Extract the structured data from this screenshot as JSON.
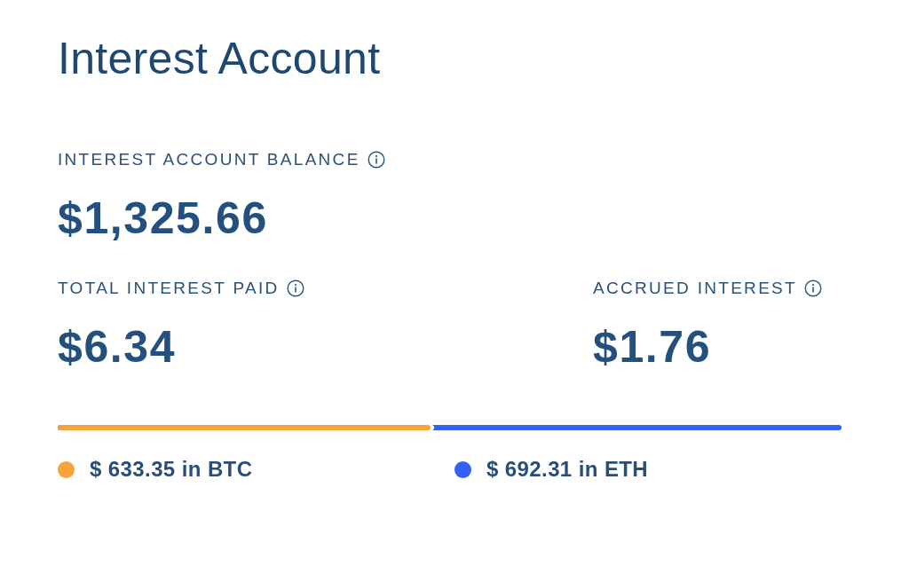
{
  "title": "Interest Account",
  "balance": {
    "label": "INTEREST ACCOUNT BALANCE",
    "value": "$1,325.66"
  },
  "stats": [
    {
      "label": "TOTAL INTEREST PAID",
      "value": "$6.34"
    },
    {
      "label": "ACCRUED INTEREST",
      "value": "$1.76"
    }
  ],
  "allocation_bar": {
    "level": 0.476
  },
  "legend": [
    {
      "label": "$ 633.35 in BTC",
      "color": "#f5a33a"
    },
    {
      "label": "$ 692.31 in ETH",
      "color": "#3360f5"
    }
  ]
}
